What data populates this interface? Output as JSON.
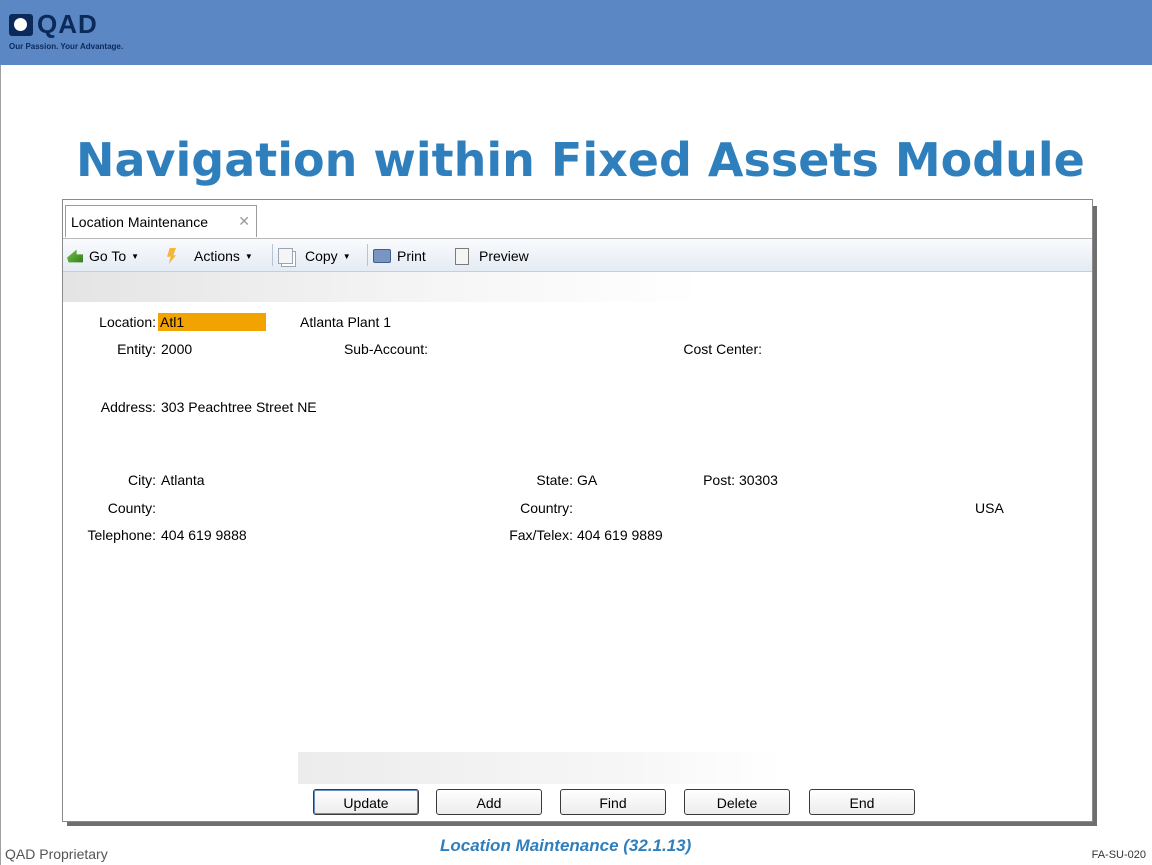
{
  "brand": {
    "logo_text": "QAD",
    "tagline": "Our Passion. Your Advantage.",
    "banner_color": "#5b87c5",
    "title_color": "#2f7fbd"
  },
  "slide": {
    "title": "Navigation within Fixed Assets Module",
    "caption": "Location Maintenance (32.1.13)",
    "footer_left": "QAD Proprietary",
    "footer_right": "FA-SU-020"
  },
  "window": {
    "tab_label": "Location Maintenance",
    "tab_close": "✕"
  },
  "toolbar": {
    "goto_label": "Go To",
    "actions_label": "Actions",
    "copy_label": "Copy",
    "print_label": "Print",
    "preview_label": "Preview",
    "caret": "▼",
    "icons": [
      "go-to-icon",
      "actions-icon",
      "copy-icon",
      "print-icon",
      "preview-icon"
    ]
  },
  "form": {
    "location_label": "Location:",
    "location_value": "Atl1",
    "location_desc": "Atlanta Plant 1",
    "highlight_color": "#f3a300",
    "entity_label": "Entity:",
    "entity_value": "2000",
    "subaccount_label": "Sub-Account:",
    "costcenter_label": "Cost Center:",
    "address_label": "Address:",
    "address_value": "303 Peachtree Street NE",
    "city_label": "City:",
    "city_value": "Atlanta",
    "state_label": "State:",
    "state_value": "GA",
    "post_label": "Post:",
    "post_value": "30303",
    "county_label": "County:",
    "country_label": "Country:",
    "country_value": "USA",
    "telephone_label": "Telephone:",
    "telephone_value": "404 619 9888",
    "fax_label": "Fax/Telex:",
    "fax_value": "404 619 9889"
  },
  "buttons": {
    "update": "Update",
    "add": "Add",
    "find": "Find",
    "delete": "Delete",
    "end": "End"
  }
}
